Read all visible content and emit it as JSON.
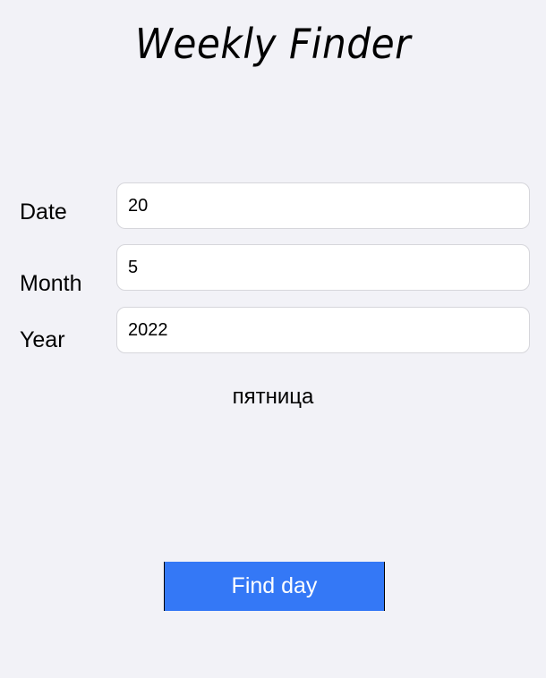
{
  "app": {
    "title": "Weekly Finder"
  },
  "form": {
    "date": {
      "label": "Date",
      "value": "20"
    },
    "month": {
      "label": "Month",
      "value": "5"
    },
    "year": {
      "label": "Year",
      "value": "2022"
    }
  },
  "result": {
    "text": "пятница"
  },
  "actions": {
    "find_label": "Find day"
  },
  "colors": {
    "background": "#f2f2f7",
    "button": "#3478f6",
    "button_text": "#ffffff"
  }
}
